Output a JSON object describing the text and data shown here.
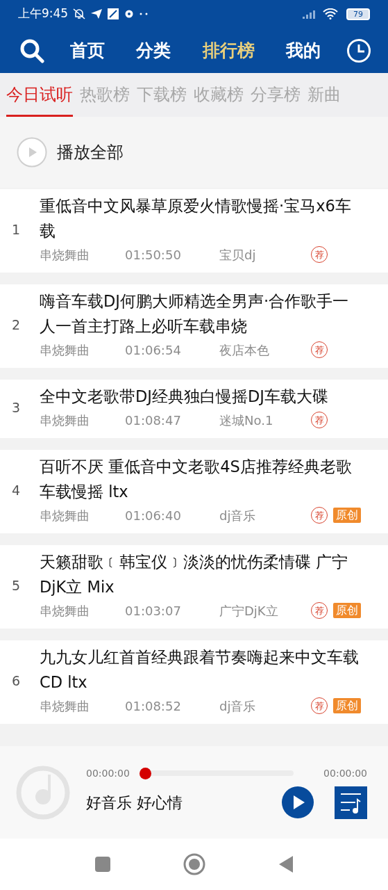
{
  "status_bar": {
    "time": "上午9:45",
    "battery": "79"
  },
  "nav": [
    {
      "label": "首页",
      "selected": false
    },
    {
      "label": "分类",
      "selected": false
    },
    {
      "label": "排行榜",
      "selected": true
    },
    {
      "label": "我的",
      "selected": false
    }
  ],
  "tabs": [
    {
      "label": "今日试听",
      "selected": true
    },
    {
      "label": "热歌榜",
      "selected": false
    },
    {
      "label": "下载榜",
      "selected": false
    },
    {
      "label": "收藏榜",
      "selected": false
    },
    {
      "label": "分享榜",
      "selected": false
    },
    {
      "label": "新曲",
      "selected": false
    }
  ],
  "play_all": {
    "label": "播放全部"
  },
  "songs": [
    {
      "rank": "1",
      "title": "重低音中文风暴草原爱火情歌慢摇·宝马x6车载",
      "genre": "串烧舞曲",
      "duration": "01:50:50",
      "artist": "宝贝dj",
      "tags": [
        {
          "kind": "recommend",
          "text": "荐"
        }
      ]
    },
    {
      "rank": "2",
      "title": "嗨音车载DJ何鹏大师精选全男声·合作歌手一人一首主打路上必听车载串烧",
      "genre": "串烧舞曲",
      "duration": "01:06:54",
      "artist": "夜店本色",
      "tags": [
        {
          "kind": "recommend",
          "text": "荐"
        }
      ]
    },
    {
      "rank": "3",
      "title": "全中文老歌带DJ经典独白慢摇DJ车载大碟",
      "genre": "串烧舞曲",
      "duration": "01:08:47",
      "artist": "迷城No.1",
      "tags": [
        {
          "kind": "recommend",
          "text": "荐"
        }
      ]
    },
    {
      "rank": "4",
      "title": "百听不厌 重低音中文老歌4S店推荐经典老歌车载慢摇 ltx",
      "genre": "串烧舞曲",
      "duration": "01:06:40",
      "artist": "dj音乐",
      "tags": [
        {
          "kind": "recommend",
          "text": "荐"
        },
        {
          "kind": "original",
          "text": "原创"
        }
      ]
    },
    {
      "rank": "5",
      "title": "天籁甜歌﹝韩宝仪﹞淡淡的忧伤柔情碟 广宁DjK立 Mix",
      "genre": "串烧舞曲",
      "duration": "01:03:07",
      "artist": "广宁DjK立",
      "tags": [
        {
          "kind": "recommend",
          "text": "荐"
        },
        {
          "kind": "original",
          "text": "原创"
        }
      ]
    },
    {
      "rank": "6",
      "title": "九九女儿红首首经典跟着节奏嗨起来中文车载CD ltx",
      "genre": "串烧舞曲",
      "duration": "01:08:52",
      "artist": "dj音乐",
      "tags": [
        {
          "kind": "recommend",
          "text": "荐"
        },
        {
          "kind": "original",
          "text": "原创"
        }
      ]
    }
  ],
  "player": {
    "elapsed": "00:00:00",
    "total": "00:00:00",
    "level": 0,
    "title": "好音乐 好心情"
  }
}
